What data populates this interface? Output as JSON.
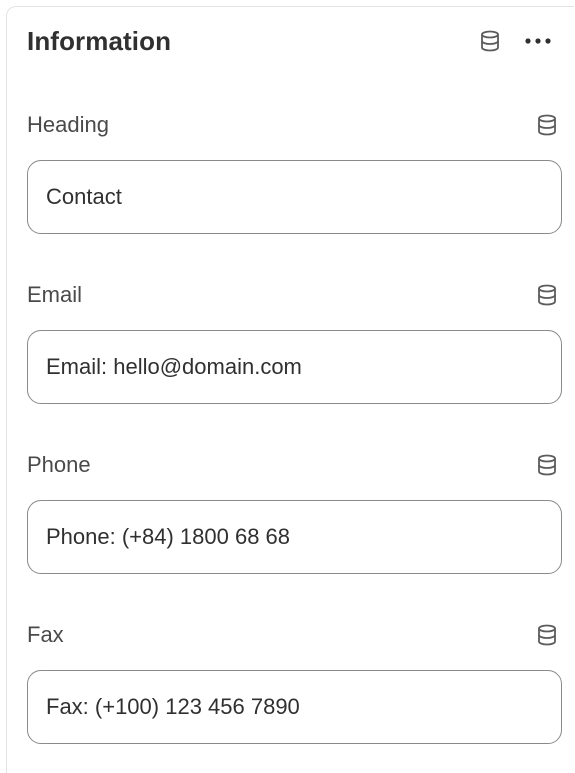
{
  "panel": {
    "title": "Information",
    "icons": [
      "database-icon",
      "more-horizontal-icon"
    ]
  },
  "fields": [
    {
      "label": "Heading",
      "value": "Contact",
      "icon": "database-icon"
    },
    {
      "label": "Email",
      "value": "Email: hello@domain.com",
      "icon": "database-icon"
    },
    {
      "label": "Phone",
      "value": "Phone: (+84) 1800 68 68",
      "icon": "database-icon"
    },
    {
      "label": "Fax",
      "value": "Fax: (+100) 123 456 7890",
      "icon": "database-icon"
    }
  ],
  "colors": {
    "text": "#303030",
    "label": "#4a4a4a",
    "border": "#8a8a8a",
    "icon": "#5c5c5c"
  }
}
